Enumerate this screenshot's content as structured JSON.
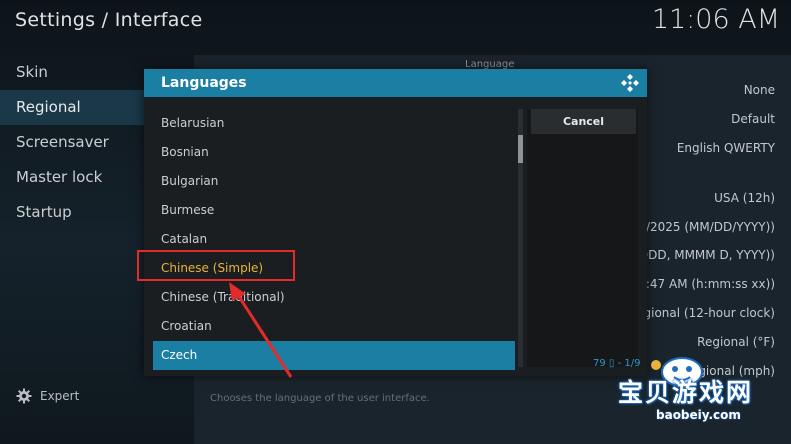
{
  "header": {
    "title": "Settings / Interface",
    "clock": "11:06 AM"
  },
  "sidebar": {
    "items": [
      {
        "label": "Skin"
      },
      {
        "label": "Regional"
      },
      {
        "label": "Screensaver"
      },
      {
        "label": "Master lock"
      },
      {
        "label": "Startup"
      }
    ],
    "active_index": 1,
    "expert_label": "Expert"
  },
  "content": {
    "section_label": "Language",
    "values": [
      "None",
      "Default",
      "English QWERTY",
      "USA (12h)",
      "/2025 (MM/DD/YYYY))",
      "DDD, MMMM D, YYYY))",
      ":47 AM (h:mm:ss xx))",
      "egional (12-hour clock)",
      "Regional (°F)",
      "gional (mph)"
    ],
    "hint": "Chooses the language of the user interface."
  },
  "dialog": {
    "title": "Languages",
    "items": [
      {
        "label": "Belarusian"
      },
      {
        "label": "Bosnian"
      },
      {
        "label": "Bulgarian"
      },
      {
        "label": "Burmese"
      },
      {
        "label": "Catalan"
      },
      {
        "label": "Chinese (Simple)"
      },
      {
        "label": "Chinese (Traditional)"
      },
      {
        "label": "Croatian"
      },
      {
        "label": "Czech"
      }
    ],
    "focused_item": "Czech",
    "highlighted_item": "Chinese (Simple)",
    "cancel_label": "Cancel",
    "count_text": "79 ▯ - 1/9",
    "accent_color": "#1a7fa3"
  },
  "annotation": {
    "color": "#e32b2b"
  },
  "watermark": {
    "title": "宝贝游戏网",
    "url": "baobeiy.com"
  }
}
